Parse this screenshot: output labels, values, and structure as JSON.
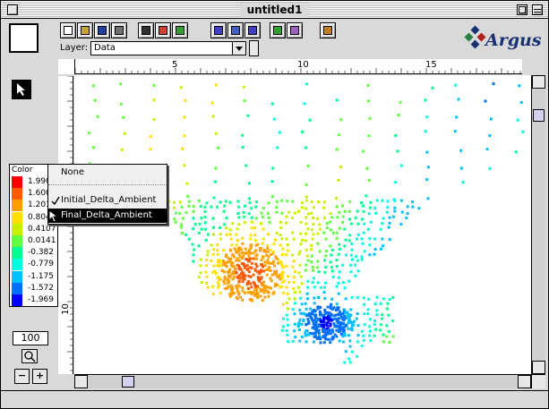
{
  "window": {
    "title": "untitled1"
  },
  "toolbar": {
    "buttons": [
      {
        "name": "new-document-icon",
        "color": "#ffffff"
      },
      {
        "name": "open-folder-icon",
        "color": "#c8a040"
      },
      {
        "name": "save-disk-icon",
        "color": "#2040a0"
      },
      {
        "name": "print-icon",
        "color": "#707070"
      },
      {
        "name": "binoculars-icon",
        "color": "#303030"
      },
      {
        "name": "color-wheel-icon",
        "color": "#d04030"
      },
      {
        "name": "layers-icon",
        "color": "#30a030"
      },
      {
        "name": "grid-window-icon",
        "color": "#4040c0"
      },
      {
        "name": "text-window-icon",
        "color": "#4060c0"
      },
      {
        "name": "values-window-icon",
        "color": "#4040c0"
      },
      {
        "name": "import-layers-icon",
        "color": "#30a030"
      },
      {
        "name": "overlay-icon",
        "color": "#a060c0"
      },
      {
        "name": "clipboard-icon",
        "color": "#c08020"
      }
    ]
  },
  "layer": {
    "label": "Layer:",
    "selected": "Data"
  },
  "logo": {
    "text": "Argus",
    "colors": [
      "#1a3070",
      "#2a8040",
      "#b02020"
    ]
  },
  "ruler": {
    "x_ticks": [
      "5",
      "10",
      "15"
    ],
    "y_ticks": [
      "10"
    ]
  },
  "legend": {
    "title": "Color",
    "entries": [
      {
        "value": "1.990",
        "color": "#ff0000"
      },
      {
        "value": "1.600",
        "color": "#ff5a00"
      },
      {
        "value": "1.201",
        "color": "#ffa000"
      },
      {
        "value": "0.804",
        "color": "#ffe000"
      },
      {
        "value": "0.4107",
        "color": "#c8f000"
      },
      {
        "value": "0.0141",
        "color": "#60ff40"
      },
      {
        "value": "-0.382",
        "color": "#00ff90"
      },
      {
        "value": "-0.779",
        "color": "#00ffe0"
      },
      {
        "value": "-1.175",
        "color": "#00c0ff"
      },
      {
        "value": "-1.572",
        "color": "#0070ff"
      },
      {
        "value": "-1.969",
        "color": "#0000ff"
      }
    ]
  },
  "zoom": {
    "value": "100",
    "out_label": "−",
    "in_label": "+"
  },
  "popup_menu": {
    "items": [
      {
        "label": "None",
        "checked": false,
        "selected": false
      },
      {
        "label": "Initial_Delta_Ambient",
        "checked": true,
        "selected": false
      },
      {
        "label": "Final_Delta_Ambient",
        "checked": false,
        "selected": true
      }
    ]
  }
}
